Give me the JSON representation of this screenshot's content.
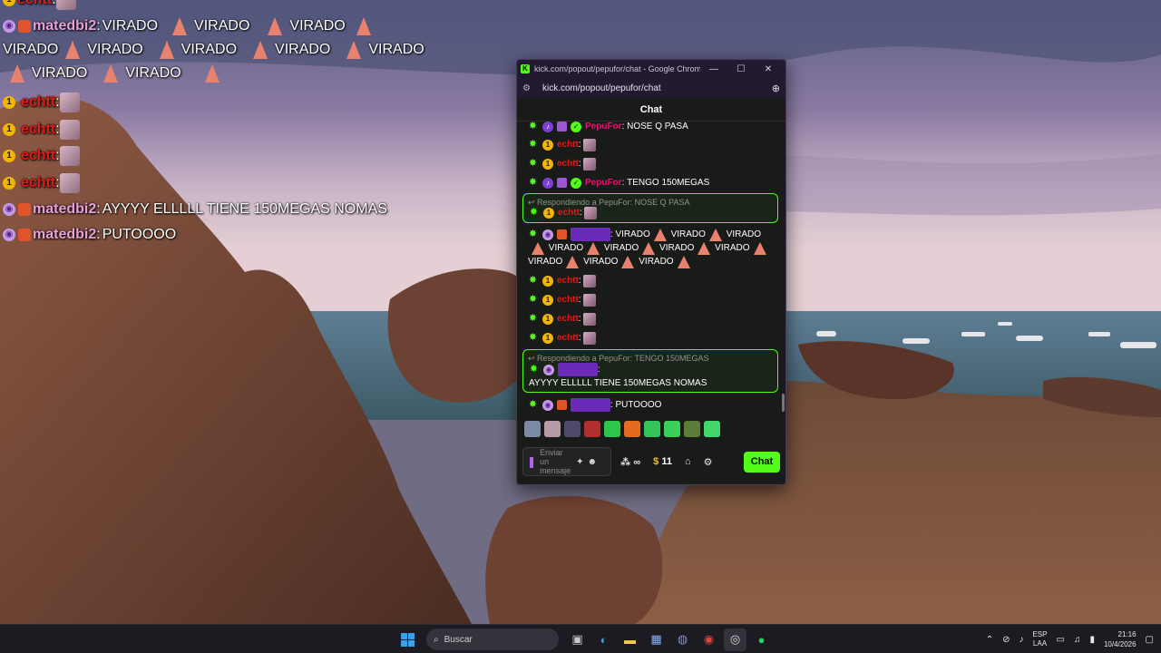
{
  "desktop_overlay": {
    "rows": [
      {
        "user": "echtt",
        "message": ""
      },
      {
        "user": "matedbi2",
        "message": "VIRADO",
        "repeat_words": [
          "VIRADO",
          "VIRADO"
        ]
      },
      {
        "continuation": [
          "VIRADO",
          "VIRADO",
          "VIRADO",
          "VIRADO",
          "VIRADO"
        ]
      },
      {
        "continuation": [
          "VIRADO",
          "VIRADO"
        ]
      },
      {
        "user": "echtt"
      },
      {
        "user": "echtt"
      },
      {
        "user": "echtt"
      },
      {
        "user": "echtt"
      },
      {
        "user": "matedbi2",
        "message": "AYYYY ELLLLL TIENE 150MEGAS NOMAS"
      },
      {
        "user": "matedbi2",
        "message": "PUTOOOO"
      }
    ]
  },
  "window": {
    "title": "kick.com/popout/pepufor/chat - Google Chrome",
    "url": "kick.com/popout/pepufor/chat",
    "controls": {
      "minimize": "—",
      "maximize": "☐",
      "close": "✕"
    }
  },
  "chat": {
    "header": "Chat",
    "messages": [
      {
        "user": "PepuFor",
        "text": "NOSE Q PASA"
      },
      {
        "user": "echtt",
        "text": ""
      },
      {
        "user": "echtt",
        "text": ""
      },
      {
        "user": "PepuFor",
        "text": "TENGO 150MEGAS"
      },
      {
        "reply_to": "Respondiendo a PepuFor: NOSE Q PASA",
        "user": "echtt",
        "text": ""
      },
      {
        "user": "matedbi2",
        "text_parts": [
          "VIRADO",
          "VIRADO",
          "VIRADO",
          "VIRADO",
          "VIRADO",
          "VIRADO",
          "VIRADO",
          "VIRADO",
          "VIRADO",
          "VIRADO"
        ]
      },
      {
        "user": "echtt",
        "text": ""
      },
      {
        "user": "echtt",
        "text": ""
      },
      {
        "user": "echtt",
        "text": ""
      },
      {
        "user": "echtt",
        "text": ""
      },
      {
        "reply_to": "Respondiendo a PepuFor: TENGO 150MEGAS",
        "user": "matedbi2",
        "text": "AYYYY ELLLLL TIENE 150MEGAS NOMAS"
      },
      {
        "user": "matedbi2",
        "text": "PUTOOOO"
      }
    ],
    "composer": {
      "placeholder": "Enviar un mensaje",
      "infinite_label": "∞",
      "coins": "11",
      "send_label": "Chat"
    }
  },
  "taskbar": {
    "search_placeholder": "Buscar",
    "language": "ESP",
    "layout": "LAA",
    "time": "21:16",
    "date": "10/4/2026"
  },
  "colors": {
    "kick_green": "#53fc18",
    "pepufor_name": "#e2156d",
    "echtt_name": "#e01a1a",
    "matedbi2_name": "#9b3cf0"
  }
}
